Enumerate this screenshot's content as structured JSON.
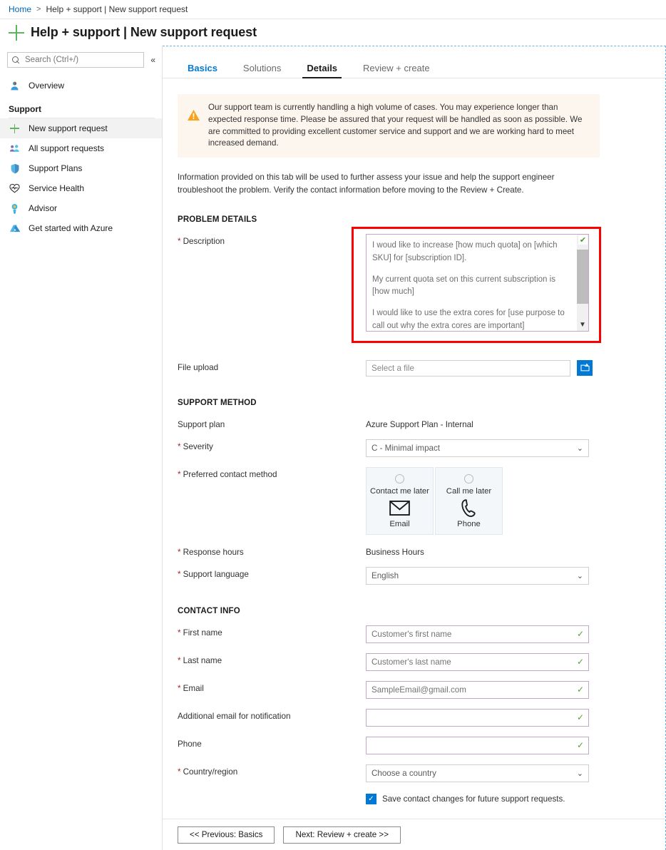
{
  "breadcrumb": {
    "home": "Home",
    "separator": ">",
    "current": "Help + support | New support request"
  },
  "header": {
    "title": "Help + support | New support request",
    "icon": "plus-icon"
  },
  "sidebar": {
    "search": {
      "placeholder": "Search (Ctrl+/)",
      "icon": "search-icon"
    },
    "collapse": "«",
    "items": [
      {
        "label": "Overview",
        "icon": "person-icon",
        "selected": false
      }
    ],
    "group_title": "Support",
    "support_items": [
      {
        "label": "New support request",
        "icon": "plus-icon",
        "selected": true
      },
      {
        "label": "All support requests",
        "icon": "people-icon",
        "selected": false
      },
      {
        "label": "Support Plans",
        "icon": "shield-icon",
        "selected": false
      },
      {
        "label": "Service Health",
        "icon": "heart-pulse-icon",
        "selected": false
      },
      {
        "label": "Advisor",
        "icon": "advisor-icon",
        "selected": false
      },
      {
        "label": "Get started with Azure",
        "icon": "azure-icon",
        "selected": false
      }
    ]
  },
  "tabs": [
    {
      "label": "Basics",
      "state": "visited"
    },
    {
      "label": "Solutions",
      "state": "default"
    },
    {
      "label": "Details",
      "state": "active"
    },
    {
      "label": "Review + create",
      "state": "default"
    }
  ],
  "alert": {
    "icon": "warning-icon",
    "text": "Our support team is currently handling a high volume of cases. You may experience longer than expected response time. Please be assured that your request will be handled as soon as possible. We are committed to providing excellent customer service and support and we are working hard to meet increased demand."
  },
  "intro": "Information provided on this tab will be used to further assess your issue and help the support engineer troubleshoot the problem. Verify the contact information before moving to the Review + Create.",
  "problem_details": {
    "heading": "PROBLEM DETAILS",
    "description": {
      "label": "Description",
      "required": true,
      "paragraphs": [
        "I woud like to increase [how much quota] on [which SKU] for [subscription ID].",
        "My current quota set on this current subscription is [how much]",
        "I would like to use the extra cores for [use purpose to call out why the extra cores are important]"
      ],
      "validation_icon": "green-check-icon",
      "scroll_down_icon": "triangle-down-icon",
      "highlight_color": "#fe0000"
    },
    "file_upload": {
      "label": "File upload",
      "required": false,
      "placeholder": "Select a file",
      "value": "",
      "button_icon": "browse-folder-icon",
      "button_color": "#0078d4"
    }
  },
  "support_method": {
    "heading": "SUPPORT METHOD",
    "support_plan": {
      "label": "Support plan",
      "required": false,
      "value": "Azure Support Plan - Internal"
    },
    "severity": {
      "label": "Severity",
      "required": true,
      "value": "C - Minimal impact"
    },
    "preferred_contact_method": {
      "label": "Preferred contact method",
      "required": true,
      "options": [
        {
          "title": "Contact me later",
          "sub": "Email",
          "icon": "envelope-icon",
          "selected": false
        },
        {
          "title": "Call me later",
          "sub": "Phone",
          "icon": "phone-icon",
          "selected": false
        }
      ]
    },
    "response_hours": {
      "label": "Response hours",
      "required": true,
      "value": "Business Hours"
    },
    "support_language": {
      "label": "Support language",
      "required": true,
      "value": "English"
    }
  },
  "contact_info": {
    "heading": "CONTACT INFO",
    "fields": [
      {
        "label": "First name",
        "required": true,
        "value": "Customer's first name",
        "valid": true,
        "type": "text"
      },
      {
        "label": "Last name",
        "required": true,
        "value": "Customer's last name",
        "valid": true,
        "type": "text"
      },
      {
        "label": "Email",
        "required": true,
        "value": "SampleEmail@gmail.com",
        "valid": true,
        "type": "text"
      },
      {
        "label": "Additional email for notification",
        "required": false,
        "value": "",
        "valid": true,
        "type": "text"
      },
      {
        "label": "Phone",
        "required": false,
        "value": "",
        "valid": true,
        "type": "text"
      },
      {
        "label": "Country/region",
        "required": true,
        "value": "Choose a country",
        "valid": false,
        "type": "select"
      }
    ],
    "save_checkbox": {
      "label": "Save contact changes for future support requests.",
      "checked": true,
      "color": "#0078d4"
    }
  },
  "footer": {
    "previous": "<< Previous: Basics",
    "next": "Next: Review + create >>"
  }
}
